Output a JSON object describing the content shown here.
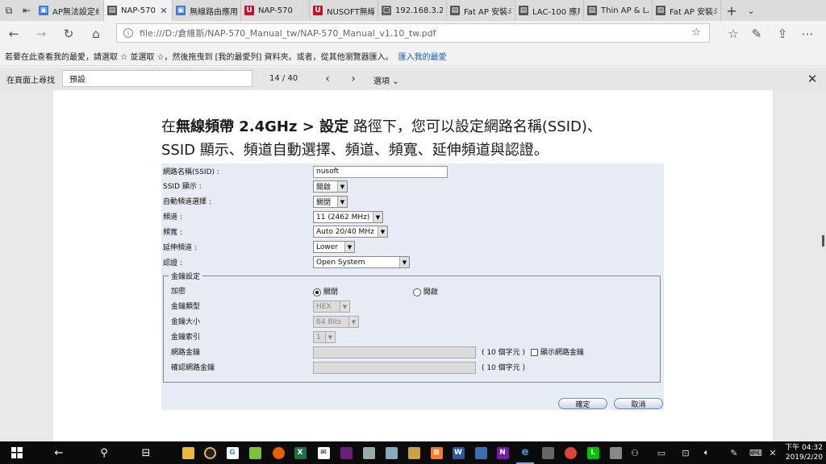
{
  "tabs": [
    {
      "title": "AP無法設定纟",
      "icon": "ap-page-icon",
      "color": "#3a7bd5",
      "glyph": "▣"
    },
    {
      "title": "NAP-570",
      "icon": "pdf-page-icon",
      "color": "#555555",
      "glyph": "▤",
      "active": true
    },
    {
      "title": "無線路由應用",
      "icon": "ap-page-icon",
      "color": "#3a7bd5",
      "glyph": "▣"
    },
    {
      "title": "NAP-570",
      "icon": "nusoft-logo-icon",
      "color": "#c8102e",
      "glyph": "U"
    },
    {
      "title": "NUSOFT無線",
      "icon": "nusoft-logo-icon",
      "color": "#c8102e",
      "glyph": "U"
    },
    {
      "title": "192.168.3.22",
      "icon": "page-icon",
      "color": "#666666",
      "glyph": "▢"
    },
    {
      "title": "Fat AP 安裝斗",
      "icon": "pdf-page-icon",
      "color": "#555555",
      "glyph": "▤"
    },
    {
      "title": "LAC-100 應用",
      "icon": "pdf-page-icon",
      "color": "#555555",
      "glyph": "▤"
    },
    {
      "title": "Thin AP & LA",
      "icon": "pdf-page-icon",
      "color": "#555555",
      "glyph": "▤"
    },
    {
      "title": "Fat AP 安裝斗",
      "icon": "pdf-page-icon",
      "color": "#555555",
      "glyph": "▤"
    }
  ],
  "address": {
    "url": "file:///D:/倉維斯/NAP-570_Manual_tw/NAP-570_Manual_v1.10_tw.pdf"
  },
  "favorites_bar": {
    "text": "若要在此查看我的最愛，請選取  ☆  並選取 ☆，然後拖曳到 [我的最愛列] 資料夾。或者，從其他瀏覽器匯入。",
    "link": "匯入我的最愛"
  },
  "find": {
    "label": "在頁面上尋找",
    "query": "預設",
    "count": "14 / 40",
    "options": "選項"
  },
  "doc": {
    "heading_pre": "在",
    "heading_bold1": "無線頻帶 2.4GHz > ",
    "heading_bold2": "設定",
    "heading_rest1": " 路徑下，您可以設定網路名稱(SSID)、",
    "heading_line2": "SSID 顯示、頻道自動選擇、頻道、頻寬、延伸頻道與認證。"
  },
  "form": {
    "ssid_label": "網路名稱(SSID) :",
    "ssid_value": "nusoft",
    "broadcast_label": "SSID 顯示 :",
    "broadcast_value": "開啟",
    "autochan_label": "自動頻道選擇 :",
    "autochan_value": "關閉",
    "channel_label": "頻道 :",
    "channel_value": "11 (2462 MHz)",
    "bandwidth_label": "頻寬 :",
    "bandwidth_value": "Auto 20/40 MHz",
    "extchan_label": "延伸頻道 :",
    "extchan_value": "Lower",
    "auth_label": "認證 :",
    "auth_value": "Open System",
    "keyset": {
      "legend": "金鑰設定",
      "encrypt_label": "加密",
      "encrypt_off": "關閉",
      "encrypt_on": "開啟",
      "keytype_label": "金鑰類型",
      "keytype_value": "HEX",
      "keysize_label": "金鑰大小",
      "keysize_value": "64 Bits",
      "keyindex_label": "金鑰索引",
      "keyindex_value": "1",
      "netkey_label": "網路金鑰",
      "netkey_note": "( 10 個字元 )",
      "show_key_label": "顯示網路金鑰",
      "confirm_label": "確認網路金鑰",
      "confirm_note": "( 10 個字元 )"
    },
    "ok_button": "確定",
    "cancel_button": "取消"
  },
  "taskbar": {
    "time": "下午 04:32",
    "date": "2019/2/20"
  }
}
